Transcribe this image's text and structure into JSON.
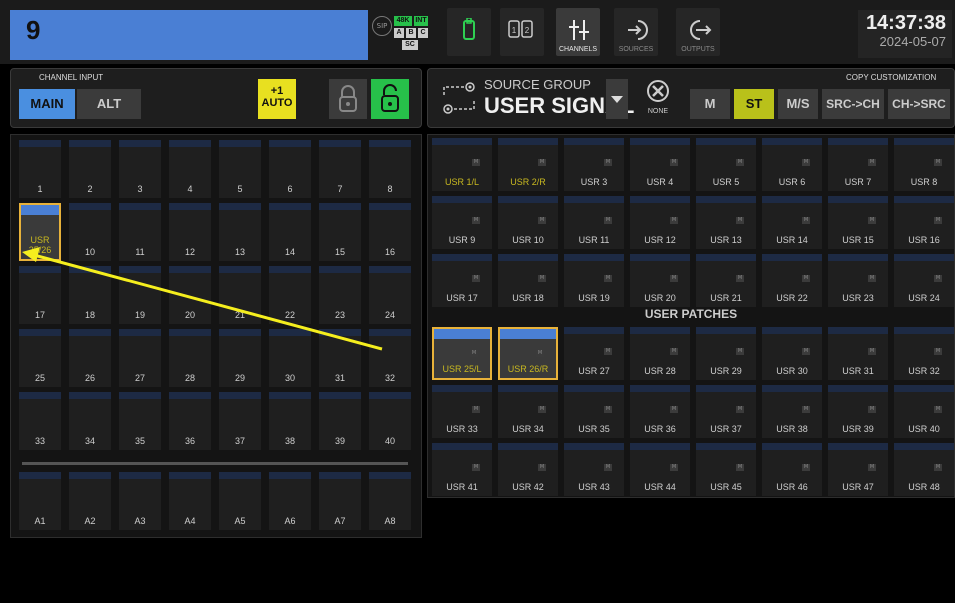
{
  "channel": {
    "name": "9"
  },
  "status": {
    "sip": "SIP",
    "rate": "48K",
    "clock_source": "INT",
    "bank": [
      "A",
      "B",
      "C"
    ],
    "sc": "SC"
  },
  "nav": {
    "channels": "CHANNELS",
    "sources": "SOURCES",
    "outputs": "OUTPUTS"
  },
  "clock": {
    "time": "14:37:38",
    "date": "2024-05-07"
  },
  "channel_input": {
    "label": "CHANNEL INPUT",
    "main": "MAIN",
    "alt": "ALT",
    "auto_line1": "+1",
    "auto_line2": "AUTO"
  },
  "source_group": {
    "label": "SOURCE GROUP",
    "value": "USER SIGNAL",
    "none": "NONE"
  },
  "mode": {
    "m": "M",
    "st": "ST",
    "ms": "M/S"
  },
  "copy": {
    "label": "COPY CUSTOMIZATION",
    "src_ch": "SRC->CH",
    "ch_src": "CH->SRC"
  },
  "patches_title": "USER PATCHES",
  "channels": [
    "1",
    "2",
    "3",
    "4",
    "5",
    "6",
    "7",
    "8",
    "USR 25/26",
    "10",
    "11",
    "12",
    "13",
    "14",
    "15",
    "16",
    "17",
    "18",
    "19",
    "20",
    "21",
    "22",
    "23",
    "24",
    "25",
    "26",
    "27",
    "28",
    "29",
    "30",
    "31",
    "32",
    "33",
    "34",
    "35",
    "36",
    "37",
    "38",
    "39",
    "40"
  ],
  "aux": [
    "A1",
    "A2",
    "A3",
    "A4",
    "A5",
    "A6",
    "A7",
    "A8"
  ],
  "sources": [
    "USR 1/L",
    "USR 2/R",
    "USR 3",
    "USR 4",
    "USR 5",
    "USR 6",
    "USR 7",
    "USR 8",
    "USR 9",
    "USR 10",
    "USR 11",
    "USR 12",
    "USR 13",
    "USR 14",
    "USR 15",
    "USR 16",
    "USR 17",
    "USR 18",
    "USR 19",
    "USR 20",
    "USR 21",
    "USR 22",
    "USR 23",
    "USR 24"
  ],
  "patches": [
    "USR 25/L",
    "USR 26/R",
    "USR 27",
    "USR 28",
    "USR 29",
    "USR 30",
    "USR 31",
    "USR 32",
    "USR 33",
    "USR 34",
    "USR 35",
    "USR 36",
    "USR 37",
    "USR 38",
    "USR 39",
    "USR 40",
    "USR 41",
    "USR 42",
    "USR 43",
    "USR 44",
    "USR 45",
    "USR 46",
    "USR 47",
    "USR 48"
  ],
  "colors": {
    "accent_blue": "#4a7fd4",
    "active_green": "#27c04a",
    "yellow": "#e8e020",
    "select": "#e8b23a"
  }
}
